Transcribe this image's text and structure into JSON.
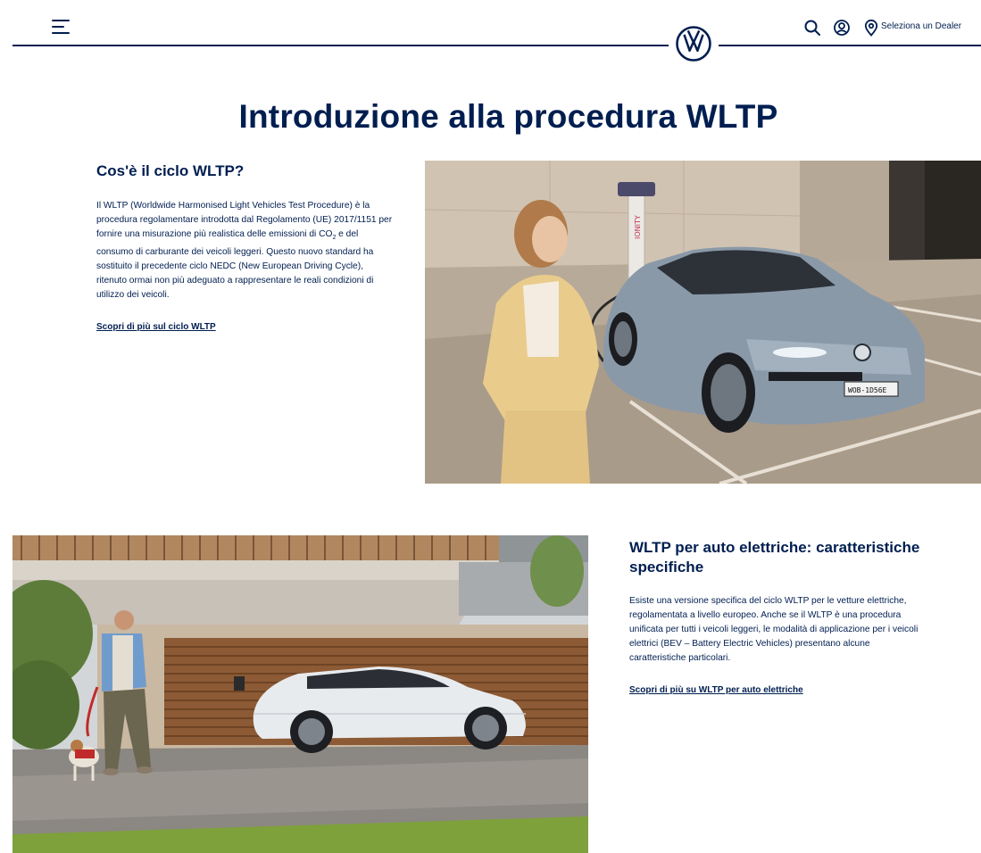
{
  "header": {
    "dealer_label": "Seleziona un Dealer"
  },
  "page": {
    "title": "Introduzione alla procedura WLTP"
  },
  "section1": {
    "heading": "Cos'è il ciclo WLTP?",
    "text_before_sub": "Il WLTP (Worldwide Harmonised Light Vehicles Test Procedure) è la procedura regolamentare introdotta dal Regolamento (UE) 2017/1151 per fornire una misurazione più realistica delle emissioni di CO",
    "text_sub": "2",
    "text_after_sub": " e del consumo di carburante dei veicoli leggeri. Questo nuovo standard ha sostituito il precedente ciclo NEDC (New European Driving Cycle), ritenuto ormai non più adeguato a rappresentare le reali condizioni di utilizzo dei veicoli.",
    "link": "Scopri di più sul ciclo WLTP",
    "image": {
      "charger_text": "IONITY",
      "plate_text": "WOB-1D56E"
    }
  },
  "section2": {
    "heading": "WLTP per auto elettriche: caratteristiche specifiche",
    "text": "Esiste una versione specifica del ciclo WLTP per le vetture elettriche, regolamentata a livello europeo. Anche se il WLTP è una procedura unificata per tutti i veicoli leggeri, le modalità di applicazione per i veicoli elettrici (BEV – Battery Electric Vehicles) presentano alcune caratteristiche particolari.",
    "link": "Scopri di più su WLTP per auto elettriche"
  },
  "colors": {
    "brand": "#001e50",
    "background": "#ffffff"
  },
  "icons": [
    "menu-icon",
    "vw-logo-icon",
    "search-icon",
    "user-icon",
    "location-pin-icon"
  ]
}
